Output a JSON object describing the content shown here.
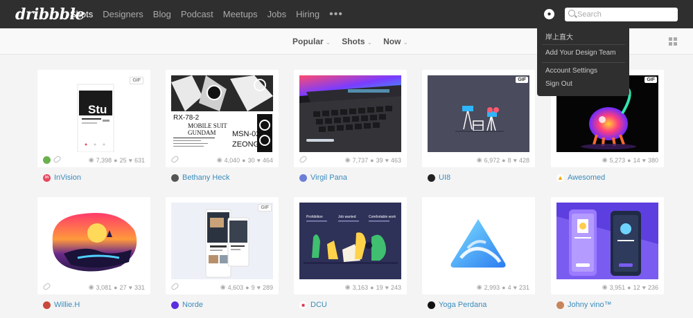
{
  "brand": {
    "logo": "dribbble"
  },
  "nav": {
    "items": [
      {
        "label": "Shots",
        "active": true
      },
      {
        "label": "Designers"
      },
      {
        "label": "Blog"
      },
      {
        "label": "Podcast"
      },
      {
        "label": "Meetups"
      },
      {
        "label": "Jobs"
      },
      {
        "label": "Hiring"
      }
    ],
    "more": "•••"
  },
  "search": {
    "placeholder": "Search"
  },
  "filters": {
    "sort": "Popular",
    "type": "Shots",
    "time": "Now"
  },
  "user_menu": {
    "username": "岸上直大",
    "items": [
      "Add Your Design Team",
      "Account Settings",
      "Sign Out"
    ]
  },
  "shots": [
    {
      "author": "InVision",
      "views": "7,398",
      "comments": "25",
      "likes": "631",
      "gif": true,
      "rebound": true
    },
    {
      "author": "Bethany Heck",
      "views": "4,040",
      "comments": "30",
      "likes": "464",
      "gif": false
    },
    {
      "author": "Virgil Pana",
      "views": "7,737",
      "comments": "39",
      "likes": "463",
      "gif": false
    },
    {
      "author": "UI8",
      "views": "6,972",
      "comments": "8",
      "likes": "428",
      "gif": true
    },
    {
      "author": "Awesomed",
      "views": "5,273",
      "comments": "14",
      "likes": "380",
      "gif": true
    },
    {
      "author": "Willie.H",
      "views": "3,081",
      "comments": "27",
      "likes": "331",
      "gif": false
    },
    {
      "author": "Norde",
      "views": "4,603",
      "comments": "9",
      "likes": "289",
      "gif": true
    },
    {
      "author": "DCU",
      "views": "3,163",
      "comments": "19",
      "likes": "243",
      "gif": false
    },
    {
      "author": "Yoga Perdana",
      "views": "2,993",
      "comments": "4",
      "likes": "231",
      "gif": false
    },
    {
      "author": "Johny vino™",
      "views": "3,951",
      "comments": "12",
      "likes": "236",
      "gif": false
    }
  ],
  "thumb_text": {
    "invision_word": "Stu",
    "poster_line1": "RX-78-2",
    "poster_line2": "MOBILE SUIT",
    "poster_line3": "GUNDAM",
    "poster_line4": "MSN-02",
    "poster_line5": "ZEONG",
    "dcu_col1": "Prohibition",
    "dcu_col2": "Job wanted",
    "dcu_col3": "Comfortable work"
  },
  "gif_label": "GIF",
  "colors": {
    "topbar": "#2f2f2f",
    "link": "#3a8bbb",
    "background": "#f4f4f4"
  }
}
